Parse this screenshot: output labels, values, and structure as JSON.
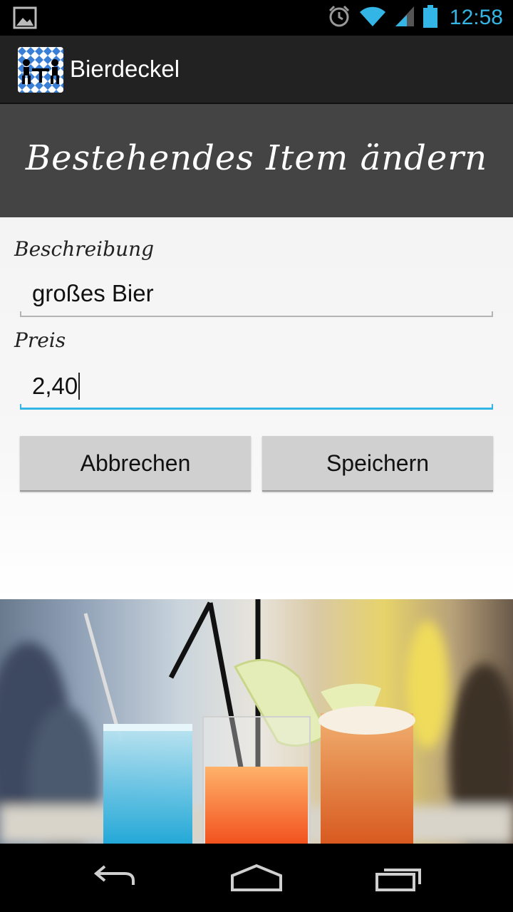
{
  "status_bar": {
    "time": "12:58",
    "icons": [
      "gallery-notification-icon",
      "alarm-icon",
      "wifi-icon",
      "signal-icon",
      "battery-icon"
    ],
    "accent_color": "#33b5e5"
  },
  "action_bar": {
    "title": "Bierdeckel",
    "icon": "bavarian-table-icon"
  },
  "header": {
    "title": "Bestehendes Item ändern"
  },
  "form": {
    "description_label": "Beschreibung",
    "description_value": "großes Bier",
    "price_label": "Preis",
    "price_value": "2,40",
    "focused_field": "price"
  },
  "buttons": {
    "cancel_label": "Abbrechen",
    "save_label": "Speichern"
  },
  "photo": {
    "subject": "cocktail-glasses-image"
  },
  "nav_bar": {
    "icons": [
      "back-icon",
      "home-icon",
      "recent-apps-icon"
    ]
  }
}
